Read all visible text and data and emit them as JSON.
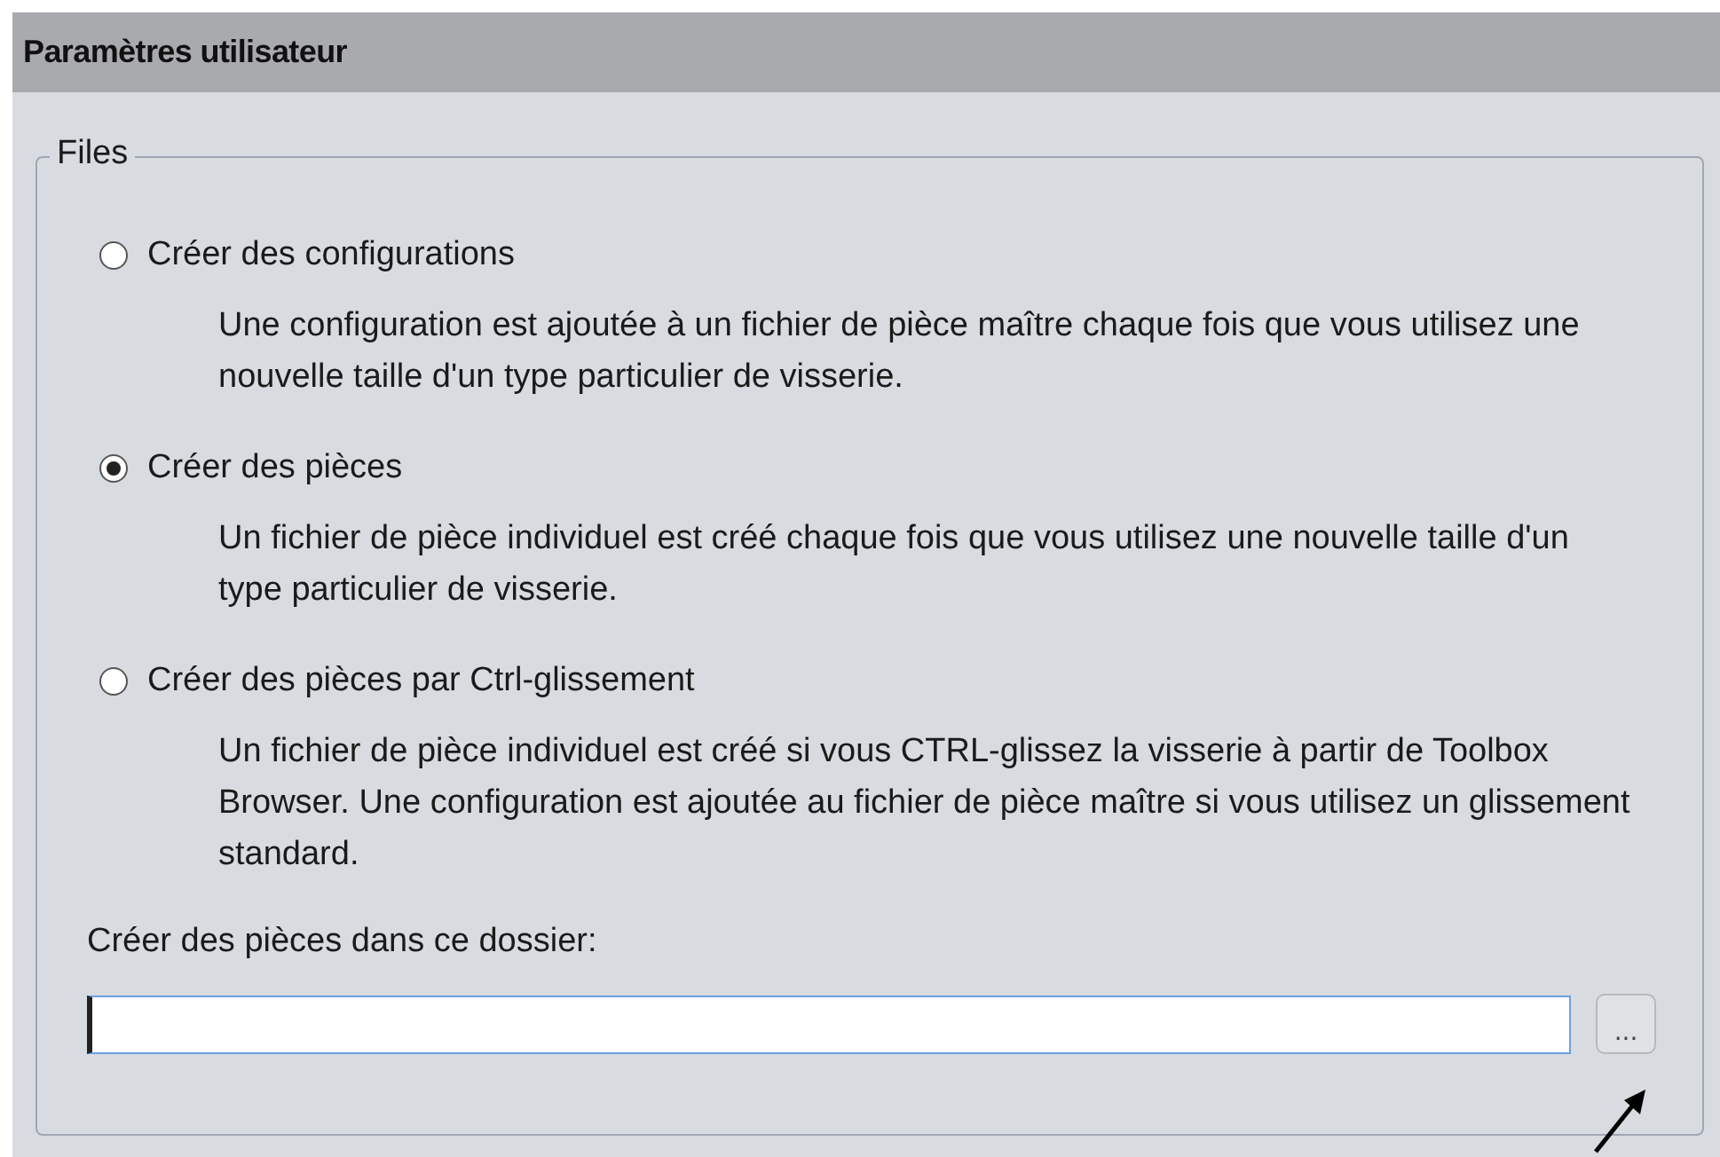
{
  "panel": {
    "title": "Paramètres utilisateur"
  },
  "group": {
    "title": "Files",
    "options": [
      {
        "label": "Créer des configurations",
        "selected": false,
        "description": "Une configuration est ajoutée à un fichier de pièce maître chaque fois que vous utilisez une nouvelle taille d'un type particulier de visserie."
      },
      {
        "label": "Créer des pièces",
        "selected": true,
        "description": "Un fichier de pièce individuel est créé chaque fois que vous utilisez une nouvelle taille d'un type particulier de visserie."
      },
      {
        "label": "Créer des pièces par Ctrl-glissement",
        "selected": false,
        "description": "Un fichier de pièce individuel est créé si vous CTRL-glissez la visserie à partir de Toolbox Browser. Une configuration est ajoutée au fichier de pièce maître si vous utilisez un glissement standard."
      }
    ],
    "folder": {
      "label": "Créer des pièces dans ce dossier:",
      "browse_button": "..."
    }
  }
}
